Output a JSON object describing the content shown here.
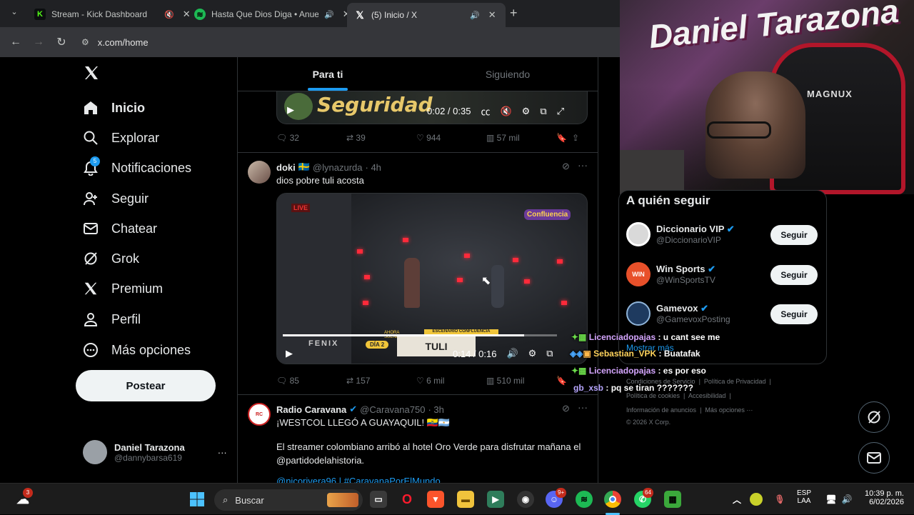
{
  "browser": {
    "tabs": [
      {
        "title": "Stream - Kick Dashboard",
        "favicon_color": "#53fc18",
        "muted": true
      },
      {
        "title": "Hasta Que Dios Diga • Anue",
        "favicon_color": "#1db954",
        "muted": false
      },
      {
        "title": "(5) Inicio / X",
        "favicon_color": "#000000",
        "muted": false
      }
    ],
    "url": "x.com/home",
    "new_tab": "+"
  },
  "sidebar": {
    "items": [
      {
        "label": "Inicio",
        "icon": "home-icon",
        "active": true
      },
      {
        "label": "Explorar",
        "icon": "search-icon"
      },
      {
        "label": "Notificaciones",
        "icon": "bell-icon",
        "badge": "5"
      },
      {
        "label": "Seguir",
        "icon": "follow-icon"
      },
      {
        "label": "Chatear",
        "icon": "mail-icon"
      },
      {
        "label": "Grok",
        "icon": "grok-icon"
      },
      {
        "label": "Premium",
        "icon": "x-logo-icon"
      },
      {
        "label": "Perfil",
        "icon": "person-icon"
      },
      {
        "label": "Más opciones",
        "icon": "more-circle-icon"
      }
    ],
    "post_button": "Postear",
    "profile": {
      "name": "Daniel Tarazona",
      "handle": "@dannybarsa619",
      "more": "···"
    }
  },
  "timeline": {
    "tabs": [
      "Para ti",
      "Siguiendo"
    ],
    "posts": [
      {
        "video_overlay": "Seguridad",
        "time": "0:02 / 0:35",
        "stats": {
          "replies": "32",
          "reposts": "39",
          "likes": "944",
          "views": "57 mil"
        }
      },
      {
        "name": "doki",
        "flag": "🇸🇪",
        "handle": "@lynazurda",
        "age": "· 4h",
        "text": "dios pobre tuli acosta",
        "video_badge_left": "LIVE",
        "video_badge_right": "Confluencia",
        "lower_third_top": "AHORA SUENA",
        "lower_third_mid": "ESCENARIO CONFLUENCIA",
        "lower_third_name": "TULI",
        "lower_third_brand": "FENIX",
        "lower_third_day": "DÍA 2",
        "time": "0:14 / 0:16",
        "video_progress": 0.88,
        "stats": {
          "replies": "85",
          "reposts": "157",
          "likes": "6 mil",
          "views": "510 mil"
        }
      },
      {
        "name": "Radio Caravana",
        "handle": "@Caravana750",
        "age": "· 3h",
        "text1": "¡WESTCOL LLEGÓ A GUAYAQUIL! 🇪🇨🇦🇷",
        "text2": "El streamer colombiano arribó al hotel Oro Verde para disfrutar mañana el @partidodelahistoria.",
        "text3": "@nicorivera96 | #CaravanaPorElMundo"
      }
    ]
  },
  "who_to_follow": {
    "title": "A quién seguir",
    "accounts": [
      {
        "name": "Diccionario VIP",
        "handle": "@DiccionarioVIP",
        "button": "Seguir",
        "avatar_color": "#d9d9d9"
      },
      {
        "name": "Win Sports",
        "handle": "@WinSportsTV",
        "button": "Seguir",
        "avatar_color": "#e8502a"
      },
      {
        "name": "Gamevox",
        "handle": "@GamevoxPosting",
        "button": "Seguir",
        "avatar_color": "#1e3a5f"
      }
    ],
    "show_more": "Mostrar más"
  },
  "footer": {
    "line1": [
      "Condiciones de Servicio",
      "Política de Privacidad"
    ],
    "line2": [
      "Política de cookies",
      "Accesibilidad"
    ],
    "line3": [
      "Información de anuncios",
      "Más opciones ···"
    ],
    "copyright": "© 2026 X Corp."
  },
  "chat": [
    {
      "user": "Licenciadopajas",
      "message": ": u cant see me",
      "color": "#d5a6ff"
    },
    {
      "user": "Sebastian_VPK",
      "message": ": Buatafak",
      "color": "#ffd35c"
    },
    {
      "user": "Licenciadopajas",
      "message": ": es por eso",
      "color": "#d5a6ff"
    },
    {
      "user": "gb_xsb",
      "message": ": pq se tiran ???????",
      "color": "#b7a6ff"
    }
  ],
  "webcam": {
    "wall_text": "Daniel Tarazona",
    "chair_text": "MAGNUX"
  },
  "taskbar": {
    "search_label": "Buscar",
    "weather_badge": "3",
    "discord_badge": "9+",
    "whatsapp_badge": "64",
    "lang_top": "ESP",
    "lang_bottom": "LAA",
    "time": "10:39 p. m.",
    "date": "6/02/2026"
  }
}
